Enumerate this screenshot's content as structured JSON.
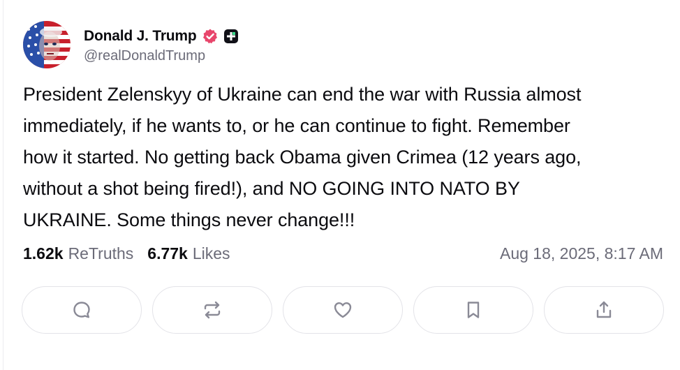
{
  "author": {
    "display_name": "Donald J. Trump",
    "handle": "@realDonaldTrump",
    "verified": true
  },
  "post": {
    "text": "President Zelenskyy of Ukraine can end the war with Russia almost\nimmediately, if he wants to, or he can continue to fight. Remember\nhow it started. No getting back Obama given Crimea (12 years ago,\nwithout a shot being fired!), and NO GOING INTO NATO BY\nUKRAINE. Some things never change!!!"
  },
  "stats": {
    "retruths_count": "1.62k",
    "retruths_label": "ReTruths",
    "likes_count": "6.77k",
    "likes_label": "Likes"
  },
  "timestamp": "Aug 18, 2025, 8:17 AM",
  "actions": [
    {
      "icon": "reply-icon"
    },
    {
      "icon": "retruth-icon"
    },
    {
      "icon": "like-icon"
    },
    {
      "icon": "bookmark-icon"
    },
    {
      "icon": "share-icon"
    }
  ],
  "colors": {
    "verified_badge": "#e8466c",
    "icon_gray": "#8a8a96",
    "muted_text": "#6b6b78",
    "border": "#e3e3e8"
  }
}
